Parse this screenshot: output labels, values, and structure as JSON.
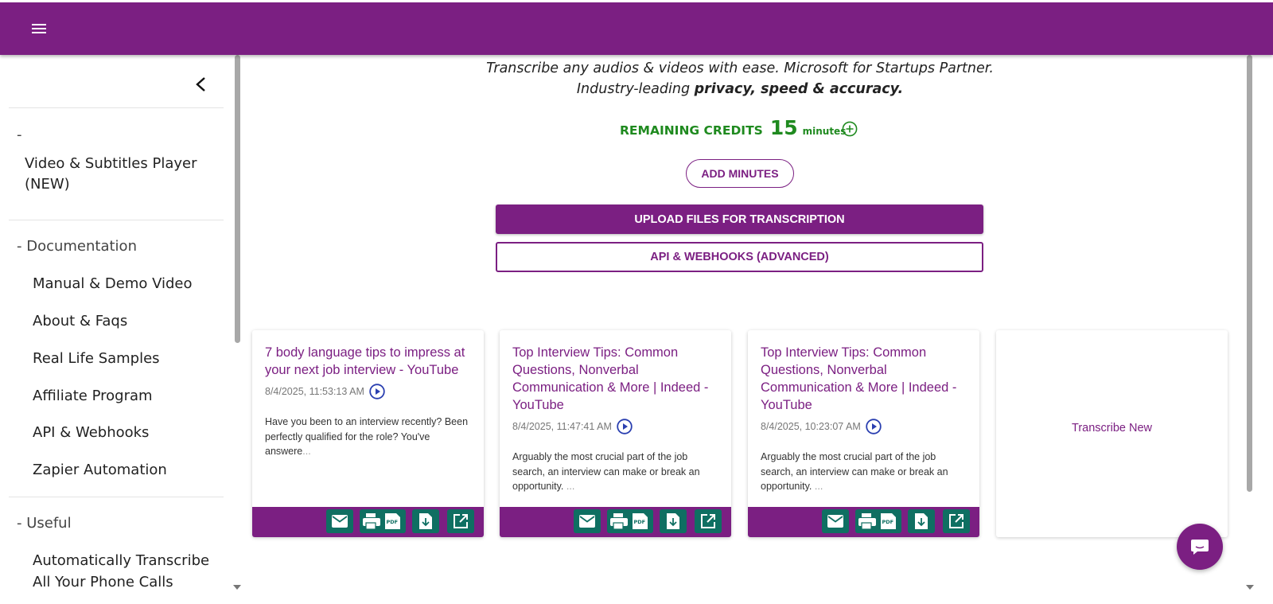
{
  "header": {
    "menu_icon": "hamburger-icon",
    "bar_color": "#7b1f82"
  },
  "sidebar": {
    "collapse_icon": "chevron-left-icon",
    "sections": [
      {
        "heading": "-",
        "items": [
          "Video & Subtitles Player",
          "(NEW)"
        ]
      },
      {
        "heading": "- Documentation",
        "items": [
          "Manual & Demo Video",
          "About & Faqs",
          "Real Life Samples",
          "Affiliate Program",
          "API & Webhooks",
          "Zapier Automation"
        ]
      },
      {
        "heading": "- Useful",
        "items": [
          "Automatically Transcribe",
          "All Your Phone Calls"
        ]
      }
    ]
  },
  "hero": {
    "line1": "Transcribe any audios & videos with ease. Microsoft for Startups Partner.",
    "line2_prefix": "Industry-leading ",
    "line2_bold": "privacy, speed & accuracy."
  },
  "credits": {
    "label": "REMAINING CREDITS",
    "value": "15",
    "unit": "minutes",
    "color": "#1f8a1f"
  },
  "buttons": {
    "add_minutes": "ADD MINUTES",
    "upload": "UPLOAD FILES FOR TRANSCRIPTION",
    "api": "API & WEBHOOKS (ADVANCED)"
  },
  "cards": [
    {
      "title": "7 body language tips to impress at your next job interview - YouTube",
      "date": "8/4/2025, 11:53:13 AM",
      "desc": "Have you been to an interview recently? Been perfectly qualified for the role? You've answere",
      "dots": "..."
    },
    {
      "title": "Top Interview Tips: Common Questions, Nonverbal Communication & More | Indeed - YouTube",
      "date": "8/4/2025, 11:47:41 AM",
      "desc": "Arguably the most crucial part of the job search, an interview can make or break an opportunity. ",
      "dots": "..."
    },
    {
      "title": "Top Interview Tips: Common Questions, Nonverbal Communication & More | Indeed - YouTube",
      "date": "8/4/2025, 10:23:07 AM",
      "desc": "Arguably the most crucial part of the job search, an interview can make or break an opportunity. ",
      "dots": "..."
    }
  ],
  "card_actions": [
    "email-icon",
    "print-pdf-icon",
    "download-icon",
    "open-external-icon"
  ],
  "transcribe_new": "Transcribe New",
  "chat_icon": "chat-icon"
}
